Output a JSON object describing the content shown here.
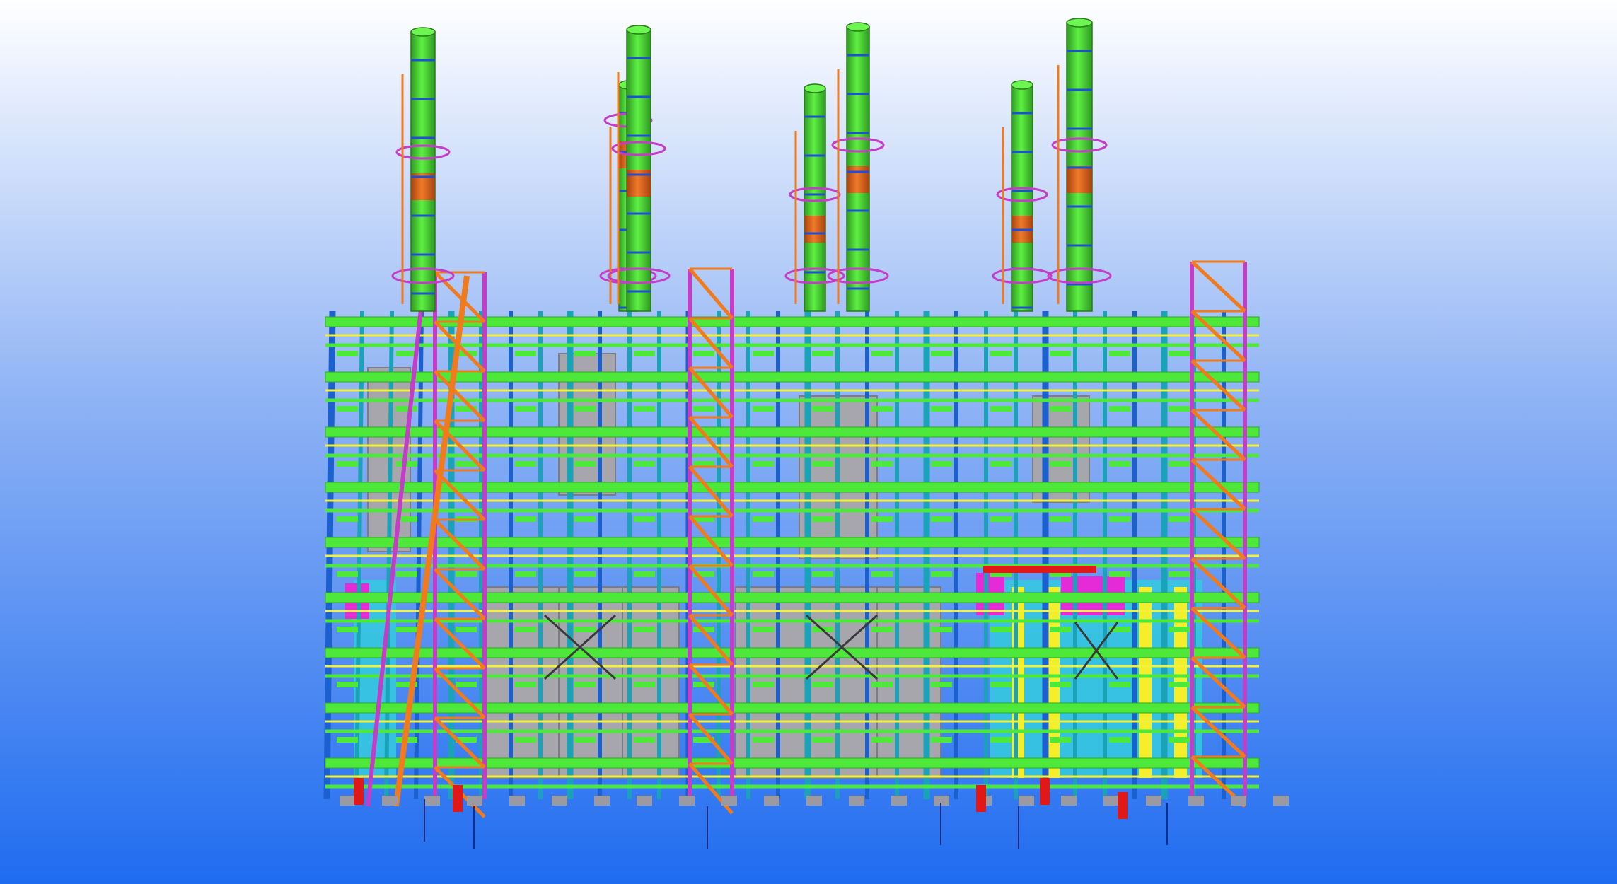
{
  "viewport": {
    "background_top": "#ffffff",
    "background_bottom": "#1f6cf0"
  },
  "palette": {
    "stack_green": "#45d62f",
    "stack_dark": "#2f9a22",
    "stack_band": "#e0661b",
    "ring_blue": "#1f4fd6",
    "column_teal": "#1aa3b8",
    "column_blue": "#1c5fcf",
    "beam_green": "#4ee83a",
    "beam_yellow": "#f2f23a",
    "stair_orange": "#f07a1c",
    "stair_magenta": "#c53cc9",
    "panel_grey": "#a6a6ac",
    "panel_cyan": "#35c8e0",
    "panel_magenta": "#e52ad8",
    "panel_yellow": "#f4ef2a",
    "accent_red": "#e01818"
  },
  "model": {
    "stacks": 8,
    "levels": 9,
    "stair_towers": 4
  }
}
